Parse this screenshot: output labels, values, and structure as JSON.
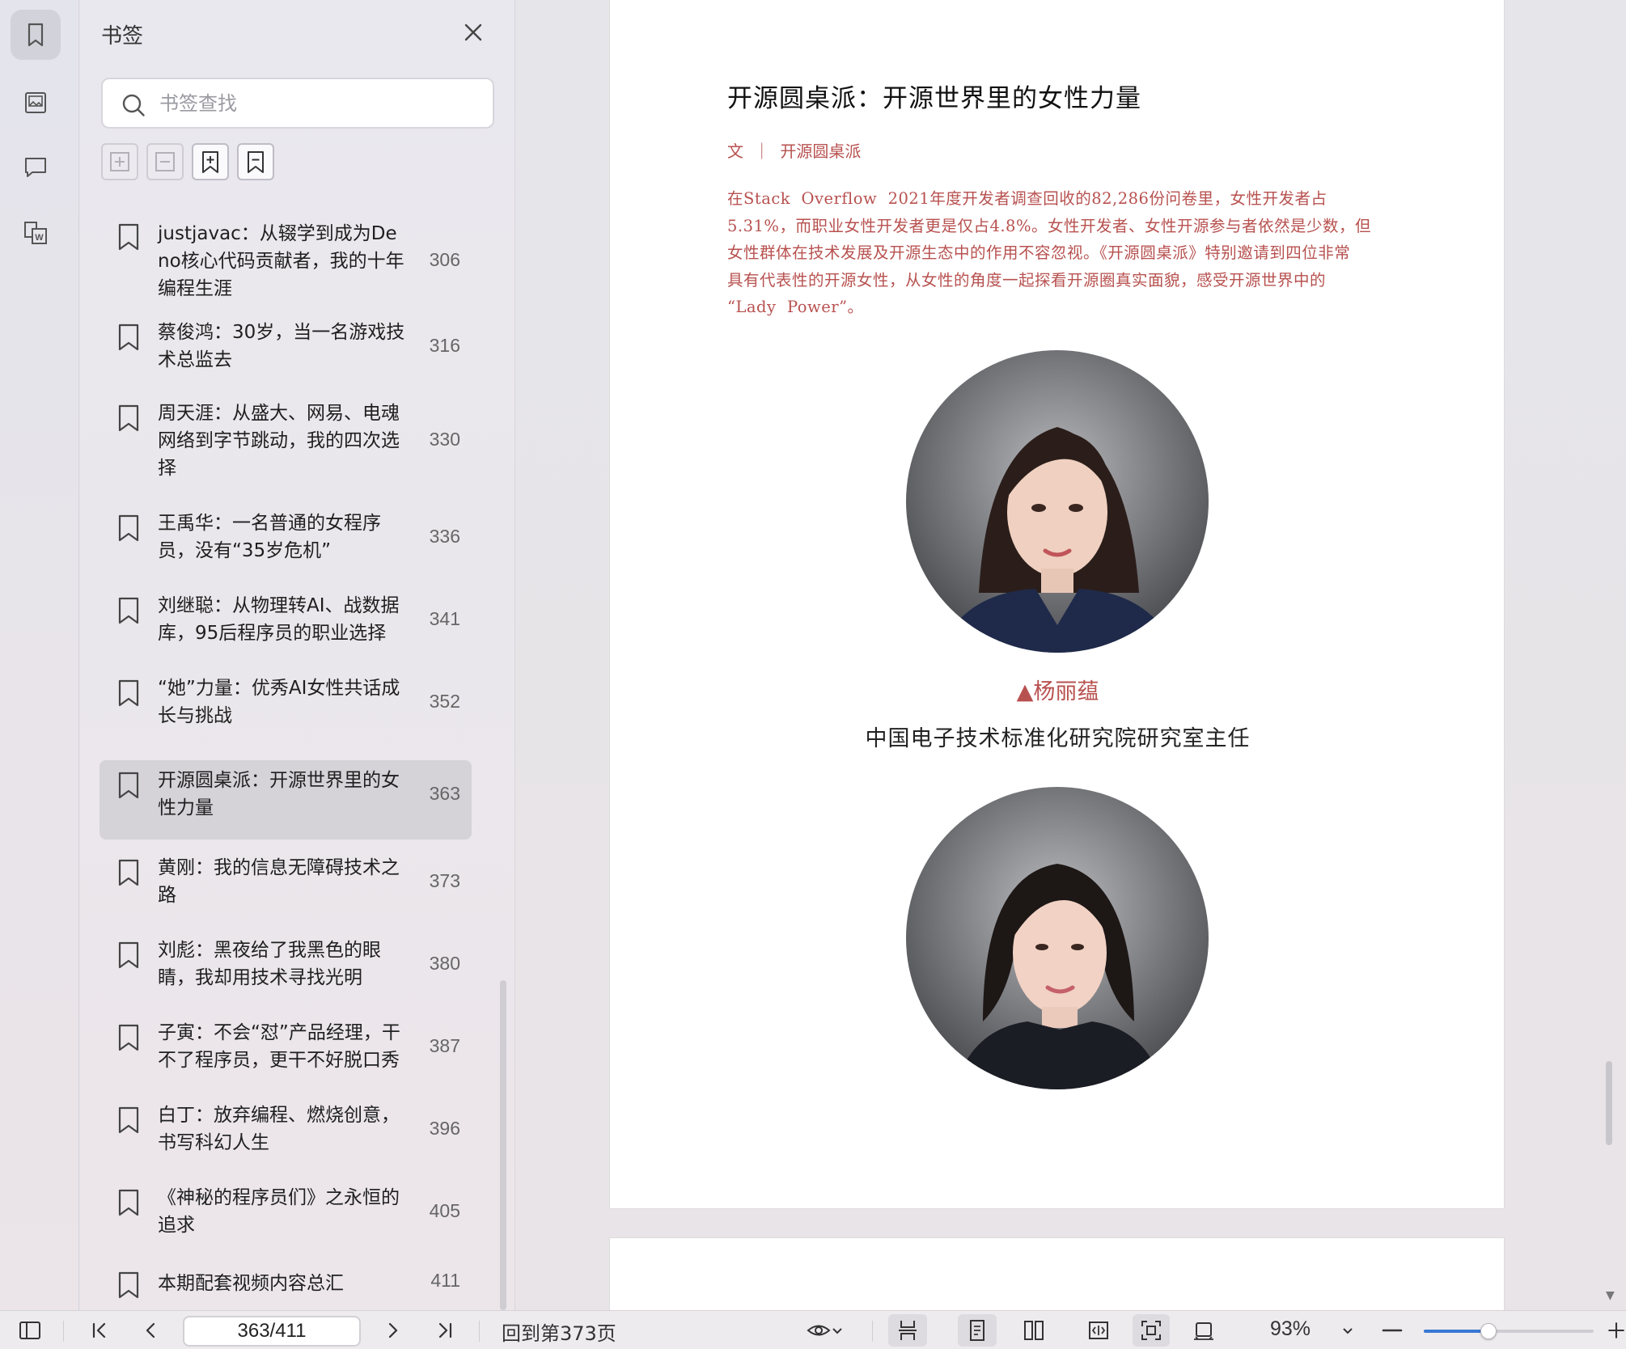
{
  "sidebar_rail": {
    "items": [
      {
        "icon": "bookmark-icon",
        "active": true
      },
      {
        "icon": "image-icon",
        "active": false
      },
      {
        "icon": "comment-icon",
        "active": false
      },
      {
        "icon": "word-export-icon",
        "active": false
      }
    ]
  },
  "bookmarks_panel": {
    "title": "书签",
    "search_placeholder": "书签查找",
    "tools": [
      "expand-all-icon",
      "collapse-all-icon",
      "add-bookmark-icon",
      "remove-bookmark-icon"
    ],
    "items": [
      {
        "title": "justjavac：从辍学到成为Deno核心代码贡献者，我的十年编程生涯",
        "page": "306"
      },
      {
        "title": "蔡俊鸿：30岁，当一名游戏技术总监去",
        "page": "316"
      },
      {
        "title": "周天涯：从盛大、网易、电魂网络到字节跳动，我的四次选择",
        "page": "330"
      },
      {
        "title": "王禹华：一名普通的女程序员，没有“35岁危机”",
        "page": "336"
      },
      {
        "title": "刘继聪：从物理转AI、战数据库，95后程序员的职业选择",
        "page": "341"
      },
      {
        "title": "“她”力量：优秀AI女性共话成长与挑战",
        "page": "352"
      },
      {
        "title": "开源圆桌派：开源世界里的女性力量",
        "page": "363",
        "selected": true
      },
      {
        "title": "黄刚：我的信息无障碍技术之路",
        "page": "373"
      },
      {
        "title": "刘彪：黑夜给了我黑色的眼睛，我却用技术寻找光明",
        "page": "380"
      },
      {
        "title": "子寅：不会“怼”产品经理，干不了程序员，更干不好脱口秀",
        "page": "387"
      },
      {
        "title": "白丁：放弃编程、燃烧创意，书写科幻人生",
        "page": "396"
      },
      {
        "title": "《神秘的程序员们》之永恒的追求",
        "page": "405"
      },
      {
        "title": "本期配套视频内容总汇",
        "page": "411"
      }
    ]
  },
  "document": {
    "article_title": "开源圆桌派：开源世界里的女性力量",
    "byline": "文  ｜  开源圆桌派",
    "intro_lines": [
      "在Stack  Overflow  2021年度开发者调查回收的82,286份问卷里，女性开发者占",
      "5.31%，而职业女性开发者更是仅占4.8%。女性开发者、女性开源参与者依然是少数，但",
      "女性群体在技术发展及开源生态中的作用不容忽视。《开源圆桌派》特别邀请到四位非常",
      "具有代表性的开源女性，从女性的角度一起探看开源圈真实面貌，感受开源世界中的",
      "“Lady  Power”。"
    ],
    "person1_name": "▲杨丽蕴",
    "person1_role": "中国电子技术标准化研究院研究室主任"
  },
  "toolbar": {
    "page_indicator": "363/411",
    "back_to_page": "回到第373页",
    "zoom": "93%",
    "zoom_level": 0.38,
    "accent_color": "#3a78d4"
  }
}
